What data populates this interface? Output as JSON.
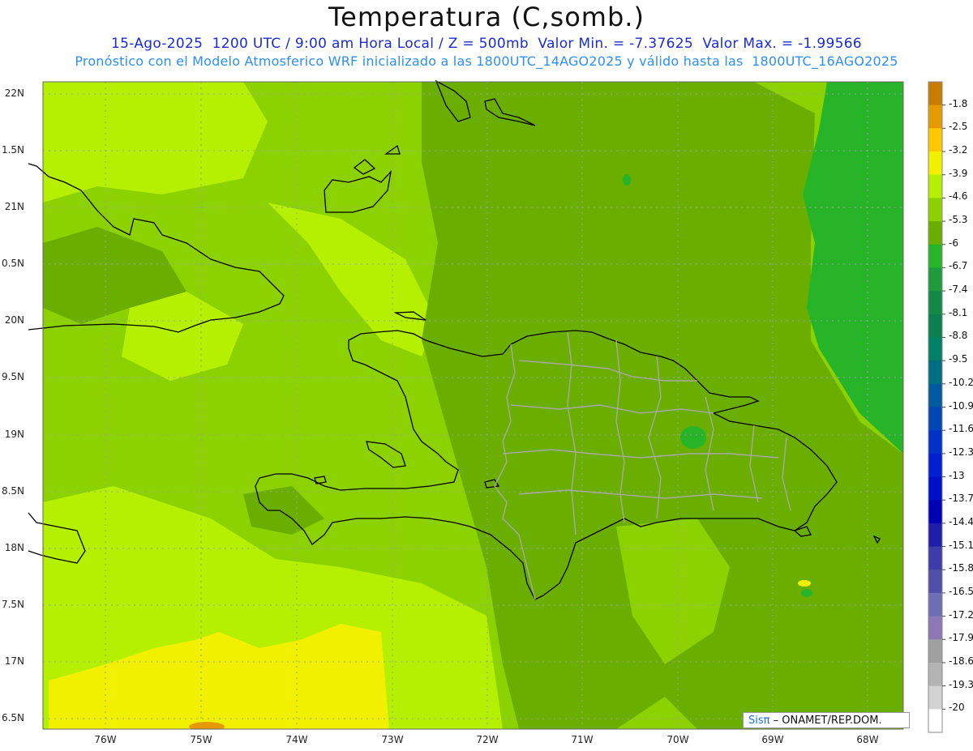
{
  "title": "Temperatura (C,somb.)",
  "subtitle_line1": "15-Ago-2025  1200 UTC / 9:00 am Hora Local / Z = 500mb  Valor Min. = -7.37625  Valor Max. = -1.99566",
  "subtitle_line2": "Pronóstico con el Modelo Atmosferico WRF inicializado a las 1800UTC_14AGO2025 y válido hasta las  1800UTC_16AGO2025",
  "credit": {
    "logo": "Sisπ",
    "text": "– ONAMET/REP.DOM."
  },
  "lat_labels": [
    "22N",
    "1.5N",
    "21N",
    "0.5N",
    "20N",
    "9.5N",
    "19N",
    "8.5N",
    "18N",
    "7.5N",
    "17N",
    "6.5N"
  ],
  "lon_labels": [
    "76W",
    "75W",
    "74W",
    "73W",
    "72W",
    "71W",
    "70W",
    "69W",
    "68W"
  ],
  "colorbar": {
    "labels": [
      "-1.8",
      "-2.5",
      "-3.2",
      "-3.9",
      "-4.6",
      "-5.3",
      "-6",
      "-6.7",
      "-7.4",
      "-8.1",
      "-8.8",
      "-9.5",
      "-10.2",
      "-10.9",
      "-11.6",
      "-12.3",
      "-13",
      "-13.7",
      "-14.4",
      "-15.1",
      "-15.8",
      "-16.5",
      "-17.2",
      "-17.9",
      "-18.6",
      "-19.3",
      "-20"
    ],
    "colors": [
      "#c87d00",
      "#e69a00",
      "#ffc800",
      "#f0f000",
      "#b4f000",
      "#8cd200",
      "#6aaf00",
      "#28b428",
      "#1e9b3c",
      "#118a46",
      "#0a8050",
      "#008064",
      "#006e82",
      "#005aa0",
      "#0046b4",
      "#0032c8",
      "#0020d2",
      "#0010c8",
      "#0000b4",
      "#1e1eaa",
      "#3c3caa",
      "#5050aa",
      "#6e6eb4",
      "#8c78b4",
      "#a0a0a0",
      "#b4b4b4",
      "#d2d2d2",
      "#ffffff"
    ]
  },
  "fill_colors": {
    "ocean_main": "#8cd200",
    "light": "#b4f000",
    "yellow": "#f0f000",
    "dark": "#6aaf00",
    "darkest": "#28b428",
    "orange": "#e69a00"
  }
}
